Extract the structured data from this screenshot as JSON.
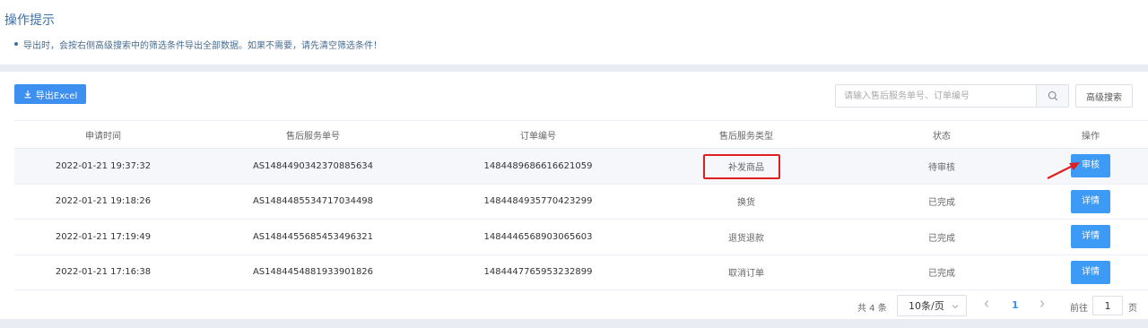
{
  "tips": {
    "title": "操作提示",
    "item": "导出时，会按右侧高级搜索中的筛选条件导出全部数据。如果不需要，请先清空筛选条件！"
  },
  "toolbar": {
    "export_label": "导出Excel",
    "search_placeholder": "请输入售后服务单号、订单编号",
    "advanced_search_label": "高级搜索"
  },
  "table": {
    "headers": [
      "申请时间",
      "售后服务单号",
      "订单编号",
      "售后服务类型",
      "状态",
      "操作"
    ],
    "rows": [
      {
        "time": "2022-01-21 19:37:32",
        "service_no": "AS1484490342370885634",
        "order_no": "1484489686616621059",
        "type": "补发商品",
        "status": "待审核",
        "action": "审核"
      },
      {
        "time": "2022-01-21 19:18:26",
        "service_no": "AS1484485534717034498",
        "order_no": "1484484935770423299",
        "type": "换货",
        "status": "已完成",
        "action": "详情"
      },
      {
        "time": "2022-01-21 17:19:49",
        "service_no": "AS1484455685453496321",
        "order_no": "1484446568903065603",
        "type": "退货退款",
        "status": "已完成",
        "action": "详情"
      },
      {
        "time": "2022-01-21 17:16:38",
        "service_no": "AS1484454881933901826",
        "order_no": "1484447765953232899",
        "type": "取消订单",
        "status": "已完成",
        "action": "详情"
      }
    ]
  },
  "pagination": {
    "total": "共 4 条",
    "page_size": "10条/页",
    "current_page": "1",
    "goto_label": "前往",
    "goto_value": "1",
    "page_suffix": "页"
  },
  "colors": {
    "primary": "#3d8ff0",
    "highlight_box": "#e02020",
    "band": "#e9edf3"
  },
  "icons": {
    "export": "download-icon",
    "search": "search-icon",
    "select": "chevron-down-icon",
    "prev": "chevron-left-icon",
    "next": "chevron-right-icon",
    "annotation": "arrow-annotation-icon"
  }
}
